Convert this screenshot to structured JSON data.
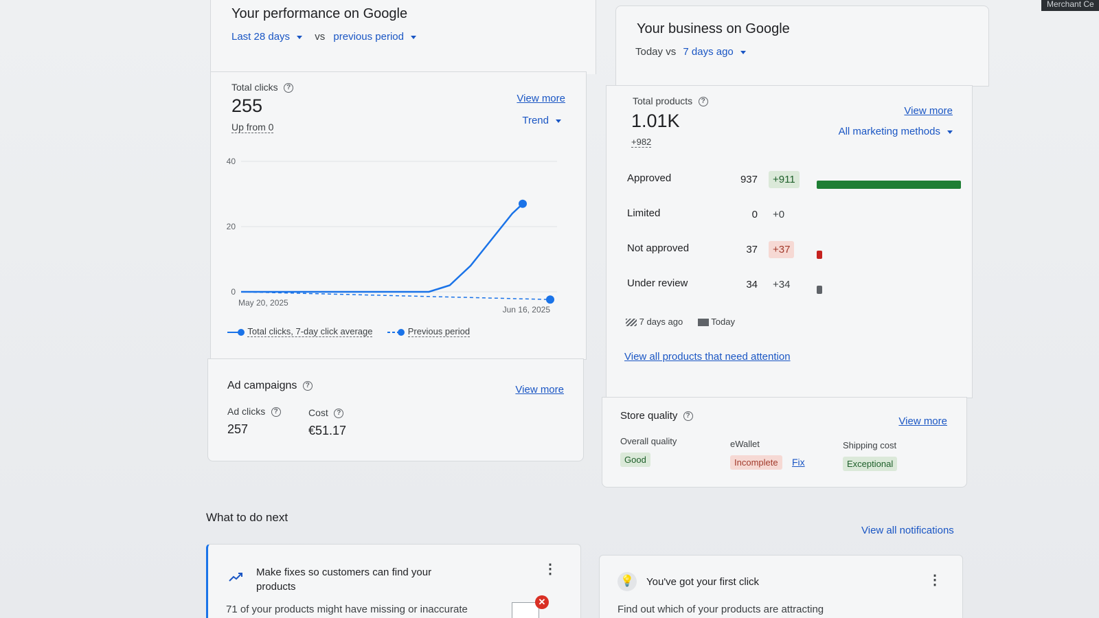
{
  "corner_tab": "Merchant Ce",
  "performance": {
    "title": "Your performance on Google",
    "period": "Last 28 days",
    "vs": "vs",
    "compare": "previous period",
    "total_clicks_label": "Total clicks",
    "total_clicks_value": "255",
    "up_from": "Up from 0",
    "view_more": "View more",
    "trend": "Trend",
    "legend_current": "Total clicks, 7-day click average",
    "legend_previous": "Previous period"
  },
  "chart_data": {
    "type": "line",
    "x_start": "May 20, 2025",
    "x_end": "Jun 16, 2025",
    "yticks": [
      "40",
      "20",
      "0"
    ],
    "ylim": [
      0,
      40
    ],
    "series": [
      {
        "name": "Total clicks, 7-day click average",
        "style": "solid",
        "color": "#1a73e8",
        "values": [
          0,
          0,
          0,
          0,
          0,
          0,
          0,
          0,
          0,
          0,
          0,
          0,
          0,
          0,
          0,
          0,
          0,
          0,
          0,
          1,
          2,
          5,
          8,
          12,
          16,
          20,
          24,
          27
        ]
      },
      {
        "name": "Previous period",
        "style": "dashed",
        "color": "#1a73e8",
        "values": [
          0,
          0,
          0,
          0,
          0,
          0,
          0,
          0,
          0,
          0,
          0,
          0,
          0,
          0,
          0,
          0,
          0,
          0,
          0,
          0,
          0,
          0,
          0,
          0,
          0,
          0,
          0,
          0,
          0
        ]
      }
    ]
  },
  "ad_campaigns": {
    "title": "Ad campaigns",
    "view_more": "View more",
    "ad_clicks_label": "Ad clicks",
    "ad_clicks_value": "257",
    "cost_label": "Cost",
    "cost_value": "€51.17"
  },
  "business": {
    "title": "Your business on Google",
    "today_vs": "Today vs",
    "compare": "7 days ago",
    "total_products_label": "Total products",
    "total_products_value": "1.01K",
    "delta": "+982",
    "view_more": "View more",
    "marketing_methods": "All marketing methods",
    "rows": [
      {
        "label": "Approved",
        "value": "937",
        "delta": "+911",
        "delta_style": "green",
        "bar_fraction": 1.0,
        "bar_color": "#1e7e34"
      },
      {
        "label": "Limited",
        "value": "0",
        "delta": "+0",
        "delta_style": "plain",
        "bar_fraction": 0,
        "bar_color": "#1e7e34"
      },
      {
        "label": "Not approved",
        "value": "37",
        "delta": "+37",
        "delta_style": "red",
        "bar_fraction": 0.04,
        "bar_color": "#c5221f"
      },
      {
        "label": "Under review",
        "value": "34",
        "delta": "+34",
        "delta_style": "plain",
        "bar_fraction": 0.036,
        "bar_color": "#5f6368"
      }
    ],
    "legend_past": "7 days ago",
    "legend_today": "Today",
    "view_all_attention": "View all products that need attention"
  },
  "store_quality": {
    "title": "Store quality",
    "view_more": "View more",
    "overall_label": "Overall quality",
    "overall_value": "Good",
    "ewallet_label": "eWallet",
    "ewallet_value": "Incomplete",
    "ewallet_fix": "Fix",
    "shipping_label": "Shipping cost",
    "shipping_value": "Exceptional"
  },
  "next": {
    "title": "What to do next",
    "view_all": "View all notifications",
    "card1_title": "Make fixes so customers can find your products",
    "card1_text": "71 of your products might have missing or inaccurate",
    "card2_title": "You've got your first click",
    "card2_text": "Find out which of your products are attracting"
  },
  "colors": {
    "link": "#1a56c4",
    "green": "#1e7e34",
    "red": "#c5221f",
    "line": "#1a73e8"
  }
}
